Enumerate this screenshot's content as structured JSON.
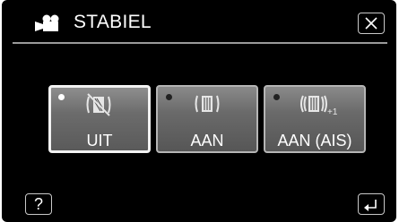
{
  "header": {
    "title": "STABIEL",
    "mode_icon": "video-camera-icon",
    "close_icon": "close-icon"
  },
  "options": [
    {
      "label": "UIT",
      "icon": "stabilizer-off-icon",
      "selected": true
    },
    {
      "label": "AAN",
      "icon": "stabilizer-on-icon",
      "selected": false
    },
    {
      "label": "AAN (AIS)",
      "icon": "stabilizer-ais-icon",
      "icon_suffix": "+1",
      "selected": false
    }
  ],
  "footer": {
    "help_label": "?",
    "back_icon": "back-return-icon"
  }
}
